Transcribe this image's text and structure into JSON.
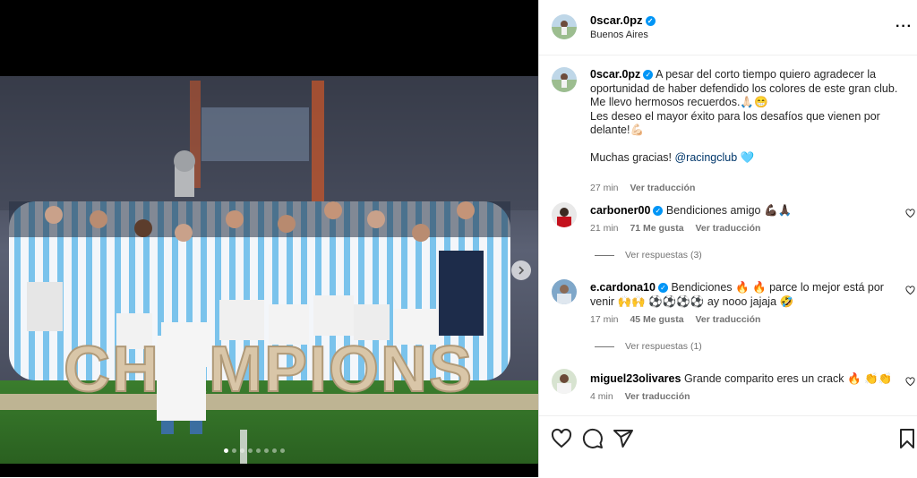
{
  "post": {
    "username": "0scar.0pz",
    "location": "Buenos Aires",
    "more_icon": "more-horizontal-icon",
    "photo_text": "CHAMPIONS",
    "carousel": {
      "total": 8,
      "active": 0
    }
  },
  "caption": {
    "username": "0scar.0pz",
    "text": "A pesar del corto tiempo quiero agradecer la oportunidad de haber defendido los colores de este gran club. Me llevo hermosos recuerdos.🙏🏻😁",
    "text2": "Les deseo el mayor éxito para los desafíos que vienen por delante!💪🏻",
    "text3_prefix": "Muchas gracias! ",
    "mention": "@racingclub",
    "text3_suffix": " 🩵",
    "time": "27 min",
    "translate": "Ver traducción"
  },
  "comments": [
    {
      "username": "carboner00",
      "text": "Bendiciones amigo 💪🏿🙏🏿",
      "time": "21 min",
      "likes": "71 Me gusta",
      "translate": "Ver traducción",
      "replies": "Ver respuestas (3)"
    },
    {
      "username": "e.cardona10",
      "text": "Bendiciones 🔥 🔥 parce lo mejor está por venir 🙌🙌 ⚽⚽⚽⚽ ay nooo jajaja 🤣",
      "time": "17 min",
      "likes": "45 Me gusta",
      "translate": "Ver traducción",
      "replies": "Ver respuestas (1)"
    },
    {
      "username": "miguel23olivares",
      "text": "Grande comparito eres un crack 🔥 👏👏",
      "time": "4 min",
      "translate": "Ver traducción"
    }
  ],
  "colors": {
    "verified": "#0095f6",
    "racing_sky_blue": "#7ac3ec",
    "muted_text": "#737373"
  }
}
